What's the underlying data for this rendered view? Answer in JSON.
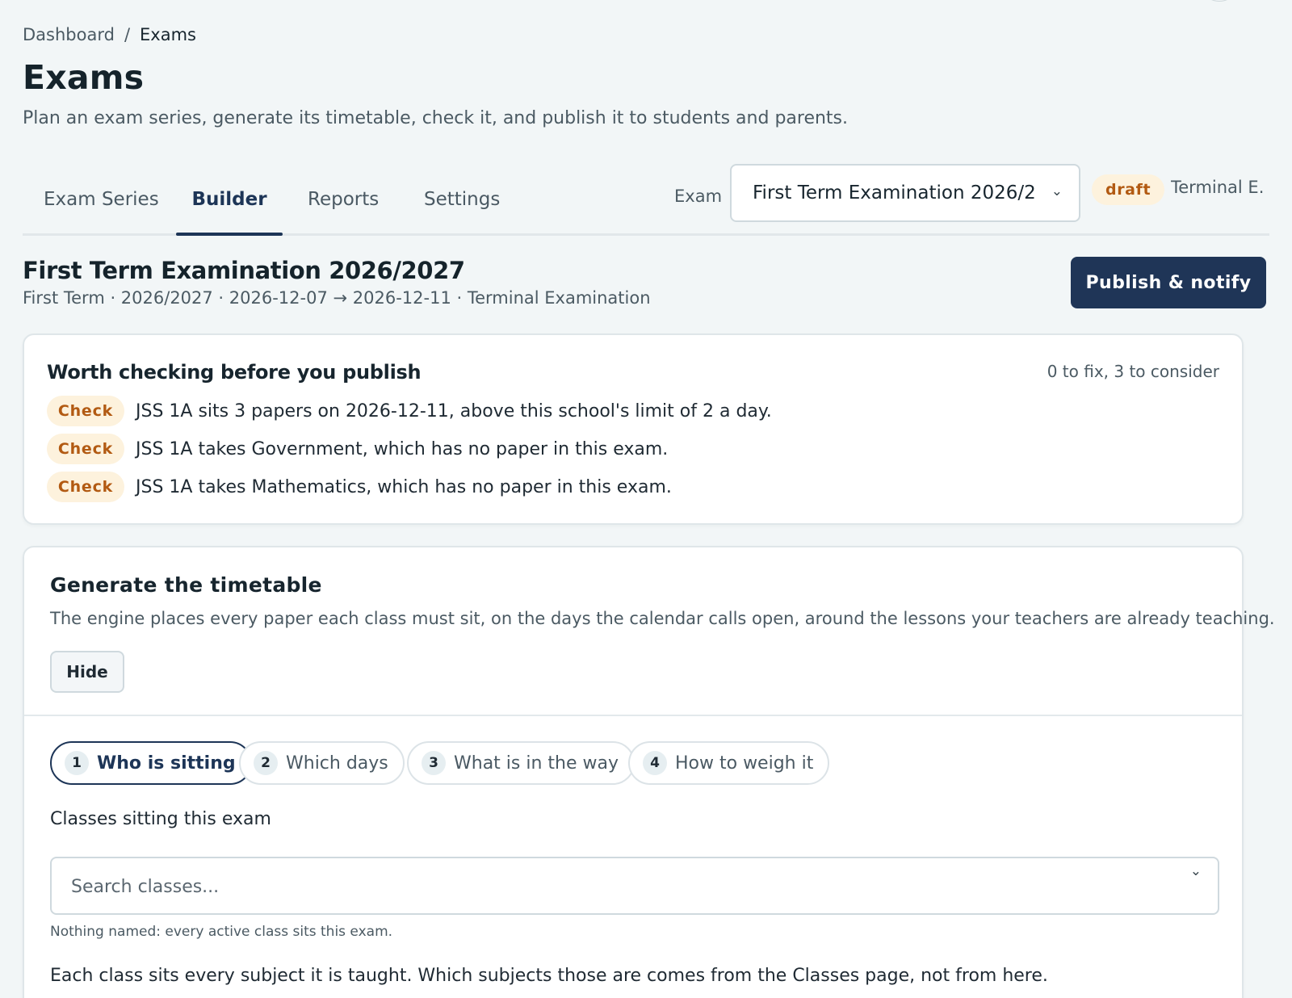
{
  "breadcrumb": {
    "root": "Dashboard",
    "separator": "/",
    "current": "Exams"
  },
  "page": {
    "title": "Exams",
    "subtitle": "Plan an exam series, generate its timetable, check it, and publish it to students and parents."
  },
  "tabs": [
    {
      "label": "Exam Series",
      "active": false
    },
    {
      "label": "Builder",
      "active": true
    },
    {
      "label": "Reports",
      "active": false
    },
    {
      "label": "Settings",
      "active": false
    }
  ],
  "exam_selector": {
    "label": "Exam",
    "selected": "First Term Examination 2026/2",
    "chevron_icon": "chevron-down-icon",
    "status": "draft",
    "type": "Terminal E..."
  },
  "series": {
    "title": "First Term Examination 2026/2027",
    "meta": "First Term · 2026/2027 · 2026-12-07 → 2026-12-11 · Terminal Examination",
    "publish_label": "Publish & notify"
  },
  "checks": {
    "title": "Worth checking before you publish",
    "summary": "0 to fix, 3 to consider",
    "items": [
      {
        "badge": "Check",
        "text": "JSS 1A sits 3 papers on 2026-12-11, above this school's limit of 2 a day."
      },
      {
        "badge": "Check",
        "text": "JSS 1A takes Government, which has no paper in this exam."
      },
      {
        "badge": "Check",
        "text": "JSS 1A takes Mathematics, which has no paper in this exam."
      }
    ]
  },
  "generator": {
    "title": "Generate the timetable",
    "description": "The engine places every paper each class must sit, on the days the calendar calls open, around the lessons your teachers are already teaching.",
    "hide_label": "Hide",
    "steps": [
      {
        "num": "1",
        "label": "Who is sitting",
        "active": true
      },
      {
        "num": "2",
        "label": "Which days",
        "active": false
      },
      {
        "num": "3",
        "label": "What is in the way",
        "active": false
      },
      {
        "num": "4",
        "label": "How to weigh it",
        "active": false
      }
    ],
    "classes_label": "Classes sitting this exam",
    "search_placeholder": "Search classes...",
    "classes_hint": "Nothing named: every active class sits this exam.",
    "classes_note": "Each class sits every subject it is taught. Which subjects those are comes from the Classes page, not from here."
  },
  "colors": {
    "primary": "#1f3557",
    "badge_bg": "#fdf2dd",
    "badge_text": "#b25a12",
    "background": "#f2f6f7"
  }
}
